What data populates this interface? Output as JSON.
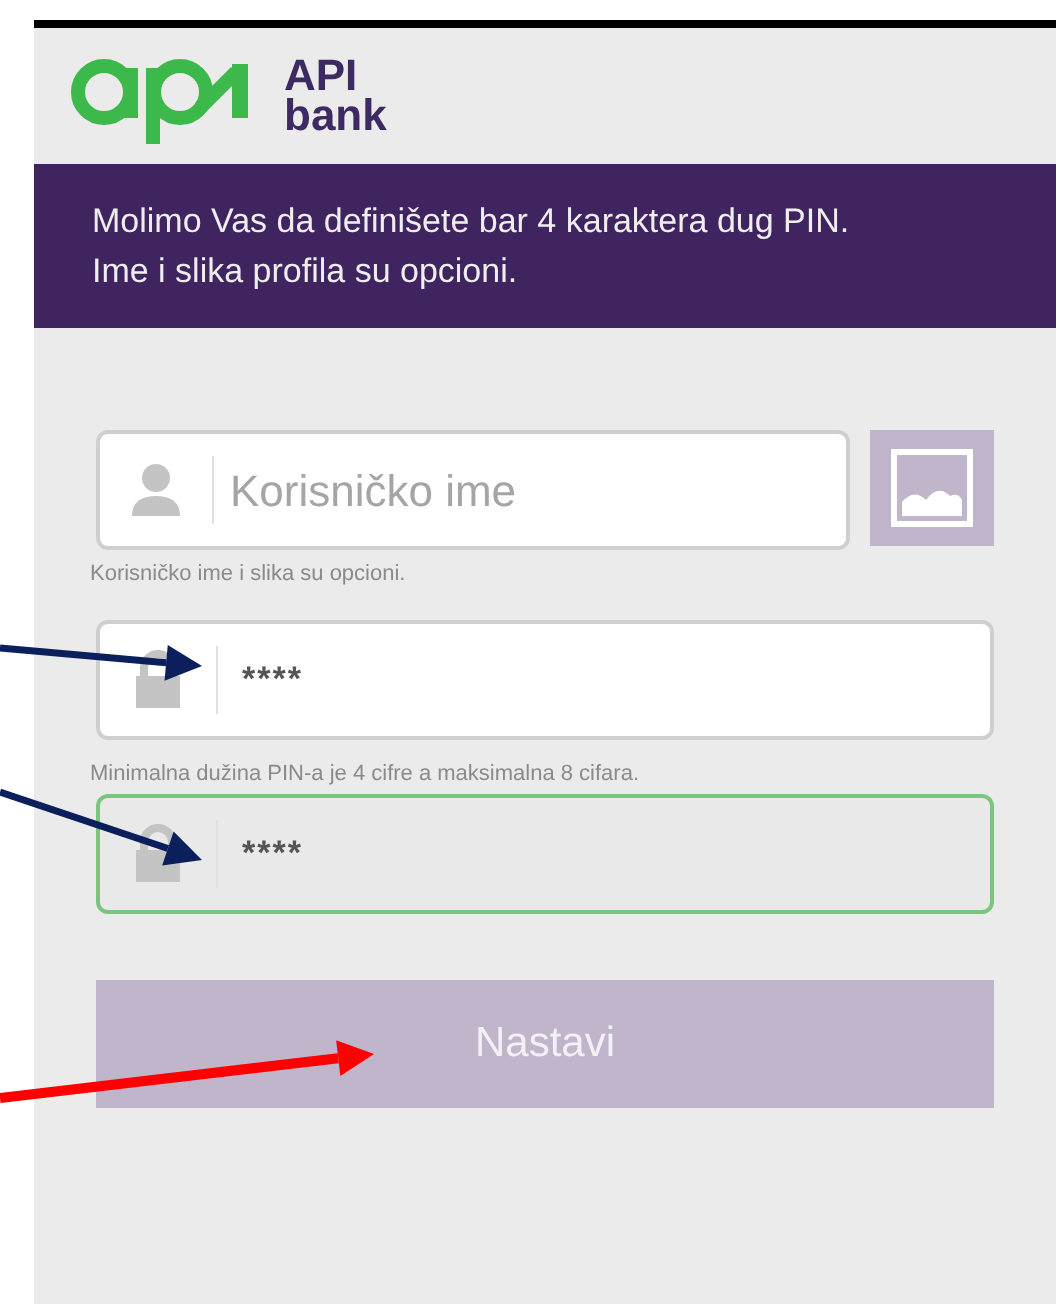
{
  "logo": {
    "line1": "API",
    "line2": "bank"
  },
  "banner": {
    "lines": [
      "Molimo Vas da definišete bar 4 karaktera dug PIN.",
      "Ime i slika profila su opcioni."
    ]
  },
  "username": {
    "placeholder": "Korisničko ime",
    "hint": "Korisničko ime i slika su opcioni."
  },
  "pin": {
    "value": "****",
    "focused": false
  },
  "pin_hint": "Minimalna dužina PIN-a je 4 cifre a maksimalna 8 cifara.",
  "pin_confirm": {
    "value": "****",
    "focused": true
  },
  "button": {
    "label": "Nastavi",
    "disabled": true
  },
  "annotations": [
    {
      "color": "#0b1f5c"
    },
    {
      "color": "#0b1f5c"
    },
    {
      "color": "#ff0000"
    }
  ]
}
